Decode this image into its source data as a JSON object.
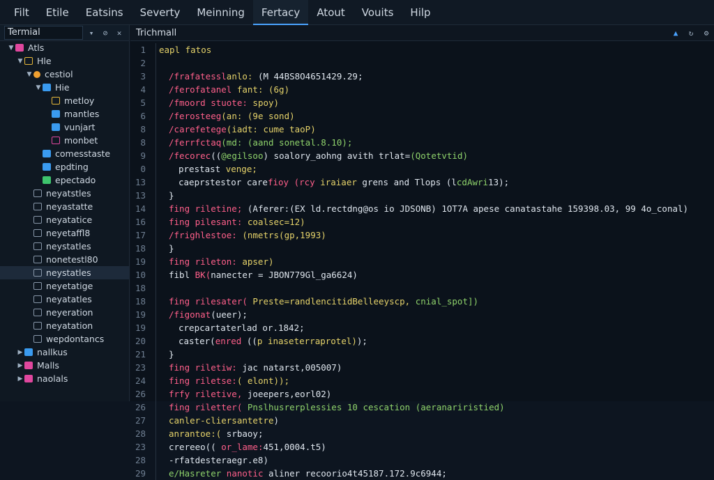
{
  "menu": [
    "Filt",
    "Etile",
    "Eatsins",
    "Severty",
    "Meinning",
    "Fertacy",
    "Atout",
    "Vouits",
    "Hilp"
  ],
  "active_menu": "Fertacy",
  "sidebar": {
    "title": "Termial",
    "items": [
      {
        "label": "Atls",
        "depth": 0,
        "chev": "down",
        "icon": "pink"
      },
      {
        "label": "Hle",
        "depth": 1,
        "chev": "down",
        "icon": "yellow-outline"
      },
      {
        "label": "cestiol",
        "depth": 2,
        "chev": "down",
        "icon": "orange-dot"
      },
      {
        "label": "Hie",
        "depth": 3,
        "chev": "down",
        "icon": "blue"
      },
      {
        "label": "metloy",
        "depth": 4,
        "chev": "",
        "icon": "yellow-outline"
      },
      {
        "label": "mantles",
        "depth": 4,
        "chev": "",
        "icon": "blue"
      },
      {
        "label": "vunjart",
        "depth": 4,
        "chev": "",
        "icon": "blue"
      },
      {
        "label": "monbet",
        "depth": 4,
        "chev": "",
        "icon": "pink-outline"
      },
      {
        "label": "comesstaste",
        "depth": 3,
        "chev": "",
        "icon": "blue"
      },
      {
        "label": "epdting",
        "depth": 3,
        "chev": "",
        "icon": "blue"
      },
      {
        "label": "epectado",
        "depth": 3,
        "chev": "",
        "icon": "green"
      },
      {
        "label": "neyatstles",
        "depth": 2,
        "chev": "",
        "icon": "gray-outline"
      },
      {
        "label": "neyastatte",
        "depth": 2,
        "chev": "",
        "icon": "gray-outline"
      },
      {
        "label": "neyatatice",
        "depth": 2,
        "chev": "",
        "icon": "gray-outline"
      },
      {
        "label": "neyetaffl8",
        "depth": 2,
        "chev": "",
        "icon": "gray-outline"
      },
      {
        "label": "neystatles",
        "depth": 2,
        "chev": "",
        "icon": "gray-outline"
      },
      {
        "label": "nonetestl80",
        "depth": 2,
        "chev": "",
        "icon": "gray-outline"
      },
      {
        "label": "neystatles",
        "depth": 2,
        "chev": "",
        "icon": "gray-outline",
        "selected": true
      },
      {
        "label": "neyetatige",
        "depth": 2,
        "chev": "",
        "icon": "gray-outline"
      },
      {
        "label": "neyatatles",
        "depth": 2,
        "chev": "",
        "icon": "gray-outline"
      },
      {
        "label": "neyeration",
        "depth": 2,
        "chev": "",
        "icon": "gray-outline"
      },
      {
        "label": "neyatation",
        "depth": 2,
        "chev": "",
        "icon": "gray-outline"
      },
      {
        "label": "wepdontancs",
        "depth": 2,
        "chev": "",
        "icon": "gray-outline"
      },
      {
        "label": "nallkus",
        "depth": 1,
        "chev": "right",
        "icon": "blue"
      },
      {
        "label": "Malls",
        "depth": 1,
        "chev": "right",
        "icon": "pink"
      },
      {
        "label": "naolals",
        "depth": 1,
        "chev": "right",
        "icon": "pink"
      }
    ]
  },
  "editor": {
    "tab_title": "Trichmall",
    "lines": [
      {
        "n": "1",
        "indent": 0,
        "segs": [
          {
            "c": "yel",
            "t": "eapl fatos"
          }
        ]
      },
      {
        "n": "2",
        "indent": 0,
        "segs": []
      },
      {
        "n": "3",
        "indent": 1,
        "segs": [
          {
            "c": "red",
            "t": "/frafatessl"
          },
          {
            "c": "yel",
            "t": "anlo: "
          },
          {
            "c": "wht",
            "t": "(M 44BS8O4651429.29;"
          }
        ]
      },
      {
        "n": "4",
        "indent": 1,
        "segs": [
          {
            "c": "red",
            "t": "/ferofatanel "
          },
          {
            "c": "yel",
            "t": "fant: (6g)"
          }
        ]
      },
      {
        "n": "5",
        "indent": 1,
        "segs": [
          {
            "c": "red",
            "t": "/fmoord stuote: "
          },
          {
            "c": "yel",
            "t": "spoy)"
          }
        ]
      },
      {
        "n": "6",
        "indent": 1,
        "segs": [
          {
            "c": "red",
            "t": "/ferosteeg"
          },
          {
            "c": "yel",
            "t": "(an: (9e sond)"
          }
        ]
      },
      {
        "n": "8",
        "indent": 1,
        "segs": [
          {
            "c": "red",
            "t": "/carefetege"
          },
          {
            "c": "yel",
            "t": "(iadt: cume taoP)"
          }
        ]
      },
      {
        "n": "8",
        "indent": 1,
        "segs": [
          {
            "c": "red",
            "t": "/ferrfctaq"
          },
          {
            "c": "grn",
            "t": "(md: (aand sonetal.8.10);"
          }
        ]
      },
      {
        "n": "9",
        "indent": 1,
        "segs": [
          {
            "c": "red",
            "t": "/fecorec"
          },
          {
            "c": "wht",
            "t": "(("
          },
          {
            "c": "grn",
            "t": "@egilsoo"
          },
          {
            "c": "wht",
            "t": ") soalory_aohng avith trlat="
          },
          {
            "c": "grn",
            "t": "(Qotetvtid)"
          }
        ]
      },
      {
        "n": "0",
        "indent": 2,
        "segs": [
          {
            "c": "wht",
            "t": "prestast "
          },
          {
            "c": "yel",
            "t": "venge;"
          }
        ]
      },
      {
        "n": "13",
        "indent": 2,
        "segs": [
          {
            "c": "wht",
            "t": "caeprstestor care"
          },
          {
            "c": "red",
            "t": "fioy (rcy "
          },
          {
            "c": "yel",
            "t": "iraiaer "
          },
          {
            "c": "wht",
            "t": "grens and Tlops (l"
          },
          {
            "c": "grn",
            "t": "cdAwri"
          },
          {
            "c": "wht",
            "t": "13);"
          }
        ]
      },
      {
        "n": "13",
        "indent": 1,
        "segs": [
          {
            "c": "wht",
            "t": "}"
          }
        ]
      },
      {
        "n": "14",
        "indent": 1,
        "segs": [
          {
            "c": "red",
            "t": "fing riletine; "
          },
          {
            "c": "wht",
            "t": "(Aferer:(EX ld.rectdng@os io JDSONB) 1OT7A apese canatastahe 159398.03, 99 4o_conal)"
          }
        ]
      },
      {
        "n": "16",
        "indent": 1,
        "segs": [
          {
            "c": "red",
            "t": "fing pilesant: "
          },
          {
            "c": "yel",
            "t": "coalsec=12)"
          }
        ]
      },
      {
        "n": "17",
        "indent": 1,
        "segs": [
          {
            "c": "red",
            "t": "/frighlestoe: "
          },
          {
            "c": "yel",
            "t": "(nmetrs(gp,1993)"
          }
        ]
      },
      {
        "n": "18",
        "indent": 1,
        "segs": [
          {
            "c": "wht",
            "t": "}"
          }
        ]
      },
      {
        "n": "19",
        "indent": 1,
        "segs": [
          {
            "c": "red",
            "t": "fing rileton: "
          },
          {
            "c": "yel",
            "t": "apser)"
          }
        ]
      },
      {
        "n": "10",
        "indent": 1,
        "segs": [
          {
            "c": "wht",
            "t": "fibl "
          },
          {
            "c": "red",
            "t": "BK("
          },
          {
            "c": "wht",
            "t": "nanecter = JBON779Gl_ga6624)"
          }
        ]
      },
      {
        "n": "18",
        "indent": 0,
        "segs": []
      },
      {
        "n": "18",
        "indent": 1,
        "segs": [
          {
            "c": "red",
            "t": "fing rilesater( "
          },
          {
            "c": "yel",
            "t": "Preste=randlencitidBelleeyscp, "
          },
          {
            "c": "grn",
            "t": "cnial_spot])"
          }
        ]
      },
      {
        "n": "19",
        "indent": 1,
        "segs": [
          {
            "c": "red",
            "t": "/figonat"
          },
          {
            "c": "wht",
            "t": "(ueer);"
          }
        ]
      },
      {
        "n": "19",
        "indent": 2,
        "segs": [
          {
            "c": "wht",
            "t": "crepcartaterlad or.1842;"
          }
        ]
      },
      {
        "n": "20",
        "indent": 2,
        "segs": [
          {
            "c": "wht",
            "t": "caster("
          },
          {
            "c": "red",
            "t": "enred "
          },
          {
            "c": "wht",
            "t": "(("
          },
          {
            "c": "yel",
            "t": "p inaseterraprotel)"
          },
          {
            "c": "wht",
            "t": ");"
          }
        ]
      },
      {
        "n": "21",
        "indent": 1,
        "segs": [
          {
            "c": "wht",
            "t": "}"
          }
        ]
      },
      {
        "n": "23",
        "indent": 1,
        "segs": [
          {
            "c": "red",
            "t": "fing riletiw: "
          },
          {
            "c": "wht",
            "t": "jac natarst,005007)"
          }
        ]
      },
      {
        "n": "24",
        "indent": 1,
        "segs": [
          {
            "c": "red",
            "t": "fing riletse:"
          },
          {
            "c": "yel",
            "t": "( elont));"
          }
        ]
      },
      {
        "n": "26",
        "indent": 1,
        "segs": [
          {
            "c": "red",
            "t": "frfy riletive, "
          },
          {
            "c": "wht",
            "t": "joeepers,eorl02)"
          }
        ]
      },
      {
        "n": "26",
        "indent": 1,
        "segs": [
          {
            "c": "red",
            "t": "fing riletter( "
          },
          {
            "c": "grn",
            "t": "Pnslhusrerplessies 10 cescation (aeranariristied)"
          }
        ]
      },
      {
        "n": "27",
        "indent": 1,
        "segs": [
          {
            "c": "yel",
            "t": "canler-cliersantetre"
          },
          {
            "c": "wht",
            "t": ")"
          }
        ]
      },
      {
        "n": "28",
        "indent": 1,
        "segs": [
          {
            "c": "yel",
            "t": "anrantoe:( "
          },
          {
            "c": "wht",
            "t": "srbaoy;"
          }
        ]
      },
      {
        "n": "23",
        "indent": 1,
        "segs": [
          {
            "c": "wht",
            "t": "crereeo(( "
          },
          {
            "c": "red",
            "t": "or_lame:"
          },
          {
            "c": "wht",
            "t": "451,0004.t5)"
          }
        ]
      },
      {
        "n": "28",
        "indent": 1,
        "segs": [
          {
            "c": "wht",
            "t": "-rfatdesteraegr.e8)"
          }
        ]
      },
      {
        "n": "29",
        "indent": 1,
        "segs": [
          {
            "c": "grn",
            "t": "e/Hasreter "
          },
          {
            "c": "red",
            "t": "nanotic "
          },
          {
            "c": "wht",
            "t": "aliner recoorio4t45187.172.9c6944;"
          }
        ]
      }
    ]
  },
  "colors": {
    "bg": "#0d1520",
    "accent": "#4aa3ff",
    "keyword": "#ff5f8a",
    "string": "#e6d36a",
    "comment": "#8fd36b"
  }
}
